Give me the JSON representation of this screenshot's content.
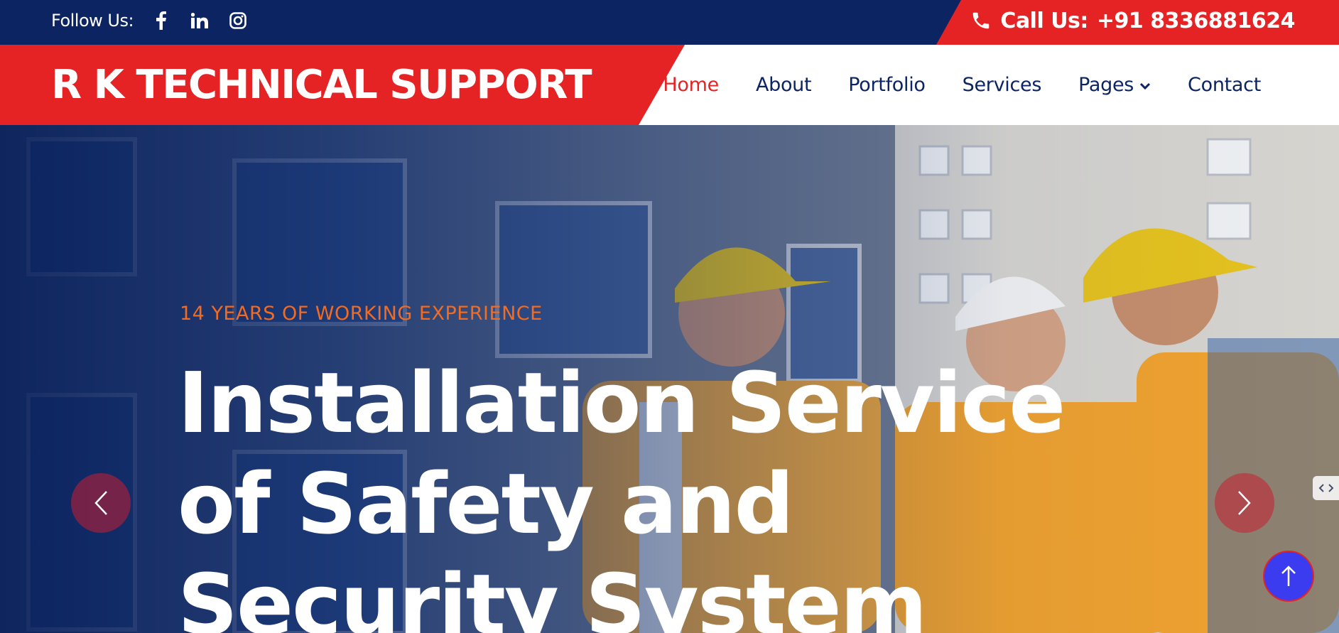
{
  "topbar": {
    "follow_label": "Follow Us:",
    "socials": [
      "facebook-icon",
      "linkedin-icon",
      "instagram-icon"
    ],
    "call_label": "Call Us:",
    "phone": "+91 8336881624"
  },
  "brand": {
    "name": "R K TECHNICAL SUPPORT"
  },
  "nav": {
    "items": [
      {
        "label": "Home",
        "active": true
      },
      {
        "label": "About"
      },
      {
        "label": "Portfolio"
      },
      {
        "label": "Services"
      },
      {
        "label": "Pages",
        "has_dropdown": true
      },
      {
        "label": "Contact"
      }
    ]
  },
  "hero": {
    "kicker": "14 YEARS OF WORKING EXPERIENCE",
    "headline": "Installation Service of Safety and Security System"
  },
  "colors": {
    "navy": "#0c2461",
    "red": "#e52324",
    "orange": "#f26b21",
    "blue_button": "#3b3bf0"
  }
}
